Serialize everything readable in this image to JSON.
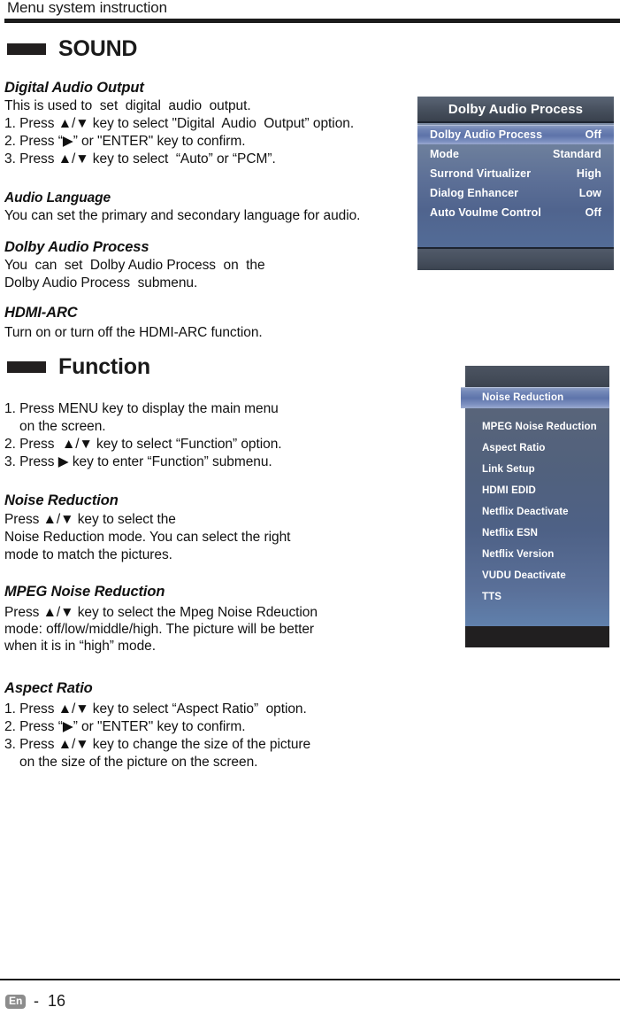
{
  "header": {
    "title": "Menu system instruction"
  },
  "sections": [
    {
      "id": "sound",
      "title": "SOUND",
      "blocks": [
        {
          "heading": "Digital Audio Output",
          "lines": [
            "This is used to  set  digital  audio  output.",
            "1. Press ▲/▼ key to select \"Digital  Audio  Output” option.",
            "2. Press “▶” or \"ENTER\" key to confirm.",
            "3. Press ▲/▼ key to select  “Auto” or “PCM”."
          ]
        },
        {
          "heading": "Audio Language",
          "lines": [
            "You can set the primary and secondary language for audio."
          ]
        },
        {
          "heading": "Dolby Audio Process",
          "lines": [
            "You  can  set  Dolby Audio Process  on  the",
            "Dolby Audio Process  submenu."
          ]
        },
        {
          "heading": "HDMI-ARC",
          "lines": [
            "Turn on or turn off the HDMI-ARC function."
          ]
        }
      ]
    },
    {
      "id": "function",
      "title": "Function",
      "blocks": [
        {
          "heading": "",
          "lines": [
            "1. Press MENU key to display the main menu",
            "    on the screen.",
            "2. Press  ▲/▼ key to select “Function” option.",
            "3. Press ▶ key to enter “Function” submenu."
          ]
        },
        {
          "heading": "Noise Reduction",
          "lines": [
            "Press ▲/▼ key to select the",
            "Noise Reduction mode. You can select the right",
            "mode to match the pictures."
          ]
        },
        {
          "heading": "MPEG Noise Reduction",
          "lines": [
            "Press ▲/▼ key to select the Mpeg Noise Rdeuction",
            "mode: off/low/middle/high. The picture will be better",
            "when it is in “high” mode."
          ]
        },
        {
          "heading": "Aspect Ratio",
          "lines": [
            "1. Press ▲/▼ key to select “Aspect Ratio”  option.",
            "2. Press “▶” or \"ENTER\" key to confirm.",
            "3. Press ▲/▼ key to change the size of the picture",
            "    on the size of the picture on the screen."
          ]
        }
      ]
    }
  ],
  "osd_dolby": {
    "title": "Dolby Audio Process",
    "rows": [
      {
        "label": "Dolby Audio Process",
        "value": "Off",
        "selected": true
      },
      {
        "label": "Mode",
        "value": "Standard",
        "selected": false
      },
      {
        "label": "Surrond  Virtualizer",
        "value": "High",
        "selected": false
      },
      {
        "label": "Dialog  Enhancer",
        "value": "Low",
        "selected": false
      },
      {
        "label": "Auto Voulme  Control",
        "value": "Off",
        "selected": false
      }
    ]
  },
  "osd_function": {
    "rows": [
      {
        "label": "Noise Reduction",
        "selected": true
      },
      {
        "label": "MPEG Noise Reduction",
        "selected": false
      },
      {
        "label": "Aspect Ratio",
        "selected": false
      },
      {
        "label": "Link  Setup",
        "selected": false
      },
      {
        "label": "HDMI EDID",
        "selected": false
      },
      {
        "label": "Netflix Deactivate",
        "selected": false
      },
      {
        "label": "Netflix ESN",
        "selected": false
      },
      {
        "label": "Netflix Version",
        "selected": false
      },
      {
        "label": "VUDU Deactivate",
        "selected": false
      },
      {
        "label": "TTS",
        "selected": false
      }
    ]
  },
  "footer": {
    "language": "En",
    "page": "-  16"
  },
  "colors": {
    "rule": "#1c1c1c",
    "osd_highlight": "#5e74aa",
    "osd_body": "#5d7097",
    "osd_titlebar": "#48515f",
    "lang_badge": "#8c8c8c"
  }
}
